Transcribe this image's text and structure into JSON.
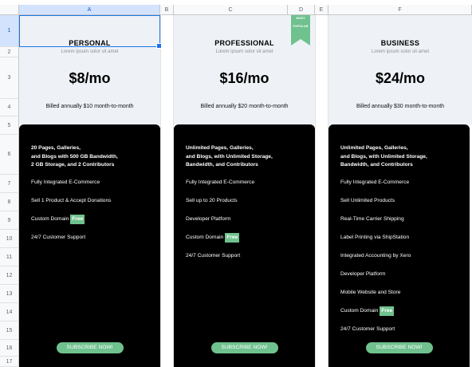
{
  "sheet": {
    "columns": [
      "A",
      "B",
      "C",
      "D",
      "E",
      "F"
    ],
    "rows": [
      "1",
      "2",
      "3",
      "4",
      "5",
      "6",
      "7",
      "8",
      "9",
      "10",
      "11",
      "12",
      "13",
      "14",
      "15",
      "16",
      "17"
    ]
  },
  "ribbon": {
    "line1": "MOST",
    "line2": "POPULAR"
  },
  "plans": [
    {
      "name": "PERSONAL",
      "subtitle": "Lorem ipsum solor sit amet",
      "price": "$8/mo",
      "billed": "Billed annually $10 month-to-month",
      "headline": [
        "20 Pages, Galleries,",
        "and Blogs with 500 GB Bandwidth,",
        "2 GB Storage, and 2 Contributors"
      ],
      "features": [
        "Fully Integrated E-Commerce",
        "Sell 1 Product & Accept Donations",
        "Custom Domain",
        "24/7 Customer Support"
      ],
      "free_badge": "Free",
      "button": "SUBSCRIBE NOW!"
    },
    {
      "name": "PROFESSIONAL",
      "subtitle": "Lorem ipsum solor sit amet",
      "price": "$16/mo",
      "billed": "Billed annually $20 month-to-month",
      "headline": [
        "Unlimited Pages, Galleries,",
        "and Blogs, with Unlimited Storage,",
        "Bandwidth, and Contributors"
      ],
      "features": [
        "Fully Integrated E-Commerce",
        "Sell up to 20 Products",
        "Developer Platform",
        "Custom Domain",
        "24/7 Customer Support"
      ],
      "free_badge": "Free",
      "button": "SUBSCRIBE NOW!"
    },
    {
      "name": "BUSINESS",
      "subtitle": "Lorem ipsum solor sit amet",
      "price": "$24/mo",
      "billed": "Billed annually $30 month-to-month",
      "headline": [
        "Unlimited Pages, Galleries,",
        "and Blogs, with Unlimited Storage,",
        "Bandwidth, and Contributors"
      ],
      "features": [
        "Fully Integrated E-Commerce",
        "Sell Unlimited Products",
        "Real-Time Carrier Shipping",
        "Label Printing via ShipStation",
        "Integrated Accounting by Xero",
        "Developer Platform",
        "Mobile Website and Store",
        "Custom Domain",
        "24/7 Customer Support"
      ],
      "free_badge": "Free",
      "button": "SUBSCRIBE NOW!"
    }
  ],
  "colors": {
    "accent": "#6fc18e",
    "panel_dark": "#000000",
    "panel_light": "#eef2f7",
    "selection": "#1a73e8"
  }
}
